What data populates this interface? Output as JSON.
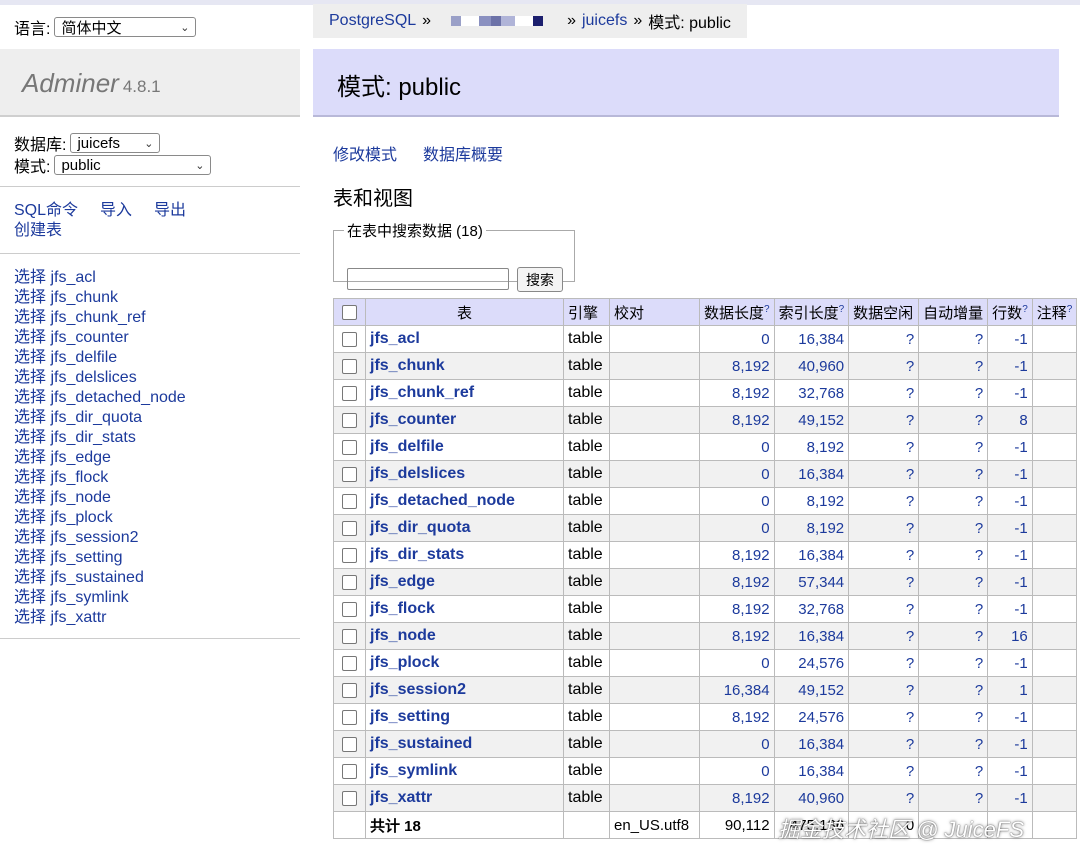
{
  "sidebar": {
    "language_label": "语言:",
    "language_value": "简体中文",
    "app_name": "Adminer",
    "version": "4.8.1",
    "db_label": "数据库:",
    "db_value": "juicefs",
    "schema_label": "模式:",
    "schema_value": "public",
    "commands": {
      "sql": "SQL命令",
      "import": "导入",
      "export": "导出",
      "create_table": "创建表"
    },
    "tables": [
      "选择 jfs_acl",
      "选择 jfs_chunk",
      "选择 jfs_chunk_ref",
      "选择 jfs_counter",
      "选择 jfs_delfile",
      "选择 jfs_delslices",
      "选择 jfs_detached_node",
      "选择 jfs_dir_quota",
      "选择 jfs_dir_stats",
      "选择 jfs_edge",
      "选择 jfs_flock",
      "选择 jfs_node",
      "选择 jfs_plock",
      "选择 jfs_session2",
      "选择 jfs_setting",
      "选择 jfs_sustained",
      "选择 jfs_symlink",
      "选择 jfs_xattr"
    ]
  },
  "breadcrumb": {
    "root": "PostgreSQL",
    "sep": "»",
    "db": "juicefs",
    "current": "模式: public"
  },
  "header": {
    "title": "模式: public"
  },
  "actions": {
    "alter_schema": "修改模式",
    "db_overview": "数据库概要"
  },
  "section_title": "表和视图",
  "search": {
    "legend": "在表中搜索数据 (18)",
    "button": "搜索",
    "value": ""
  },
  "table": {
    "headers": [
      "表",
      "引擎",
      "校对",
      "数据长度",
      "索引长度",
      "数据空闲",
      "自动增量",
      "行数",
      "注释"
    ],
    "help_mark": "?",
    "rows": [
      {
        "name": "jfs_acl",
        "engine": "table",
        "data": "0",
        "index": "16,384",
        "free": "?",
        "auto": "?",
        "rows": "-1"
      },
      {
        "name": "jfs_chunk",
        "engine": "table",
        "data": "8,192",
        "index": "40,960",
        "free": "?",
        "auto": "?",
        "rows": "-1"
      },
      {
        "name": "jfs_chunk_ref",
        "engine": "table",
        "data": "8,192",
        "index": "32,768",
        "free": "?",
        "auto": "?",
        "rows": "-1"
      },
      {
        "name": "jfs_counter",
        "engine": "table",
        "data": "8,192",
        "index": "49,152",
        "free": "?",
        "auto": "?",
        "rows": "8"
      },
      {
        "name": "jfs_delfile",
        "engine": "table",
        "data": "0",
        "index": "8,192",
        "free": "?",
        "auto": "?",
        "rows": "-1"
      },
      {
        "name": "jfs_delslices",
        "engine": "table",
        "data": "0",
        "index": "16,384",
        "free": "?",
        "auto": "?",
        "rows": "-1"
      },
      {
        "name": "jfs_detached_node",
        "engine": "table",
        "data": "0",
        "index": "8,192",
        "free": "?",
        "auto": "?",
        "rows": "-1"
      },
      {
        "name": "jfs_dir_quota",
        "engine": "table",
        "data": "0",
        "index": "8,192",
        "free": "?",
        "auto": "?",
        "rows": "-1"
      },
      {
        "name": "jfs_dir_stats",
        "engine": "table",
        "data": "8,192",
        "index": "16,384",
        "free": "?",
        "auto": "?",
        "rows": "-1"
      },
      {
        "name": "jfs_edge",
        "engine": "table",
        "data": "8,192",
        "index": "57,344",
        "free": "?",
        "auto": "?",
        "rows": "-1"
      },
      {
        "name": "jfs_flock",
        "engine": "table",
        "data": "8,192",
        "index": "32,768",
        "free": "?",
        "auto": "?",
        "rows": "-1"
      },
      {
        "name": "jfs_node",
        "engine": "table",
        "data": "8,192",
        "index": "16,384",
        "free": "?",
        "auto": "?",
        "rows": "16"
      },
      {
        "name": "jfs_plock",
        "engine": "table",
        "data": "0",
        "index": "24,576",
        "free": "?",
        "auto": "?",
        "rows": "-1"
      },
      {
        "name": "jfs_session2",
        "engine": "table",
        "data": "16,384",
        "index": "49,152",
        "free": "?",
        "auto": "?",
        "rows": "1"
      },
      {
        "name": "jfs_setting",
        "engine": "table",
        "data": "8,192",
        "index": "24,576",
        "free": "?",
        "auto": "?",
        "rows": "-1"
      },
      {
        "name": "jfs_sustained",
        "engine": "table",
        "data": "0",
        "index": "16,384",
        "free": "?",
        "auto": "?",
        "rows": "-1"
      },
      {
        "name": "jfs_symlink",
        "engine": "table",
        "data": "0",
        "index": "16,384",
        "free": "?",
        "auto": "?",
        "rows": "-1"
      },
      {
        "name": "jfs_xattr",
        "engine": "table",
        "data": "8,192",
        "index": "40,960",
        "free": "?",
        "auto": "?",
        "rows": "-1"
      }
    ],
    "footer": {
      "label": "共计 18",
      "collation": "en_US.utf8",
      "data": "90,112",
      "index": "475,136",
      "free": "0"
    }
  },
  "watermark": "掘金技术社区 @ JuiceFS",
  "colors": {
    "link": "#1c3a9c",
    "header_bg": "#dcdcfa",
    "sidebar_bg": "#eeeeee"
  }
}
